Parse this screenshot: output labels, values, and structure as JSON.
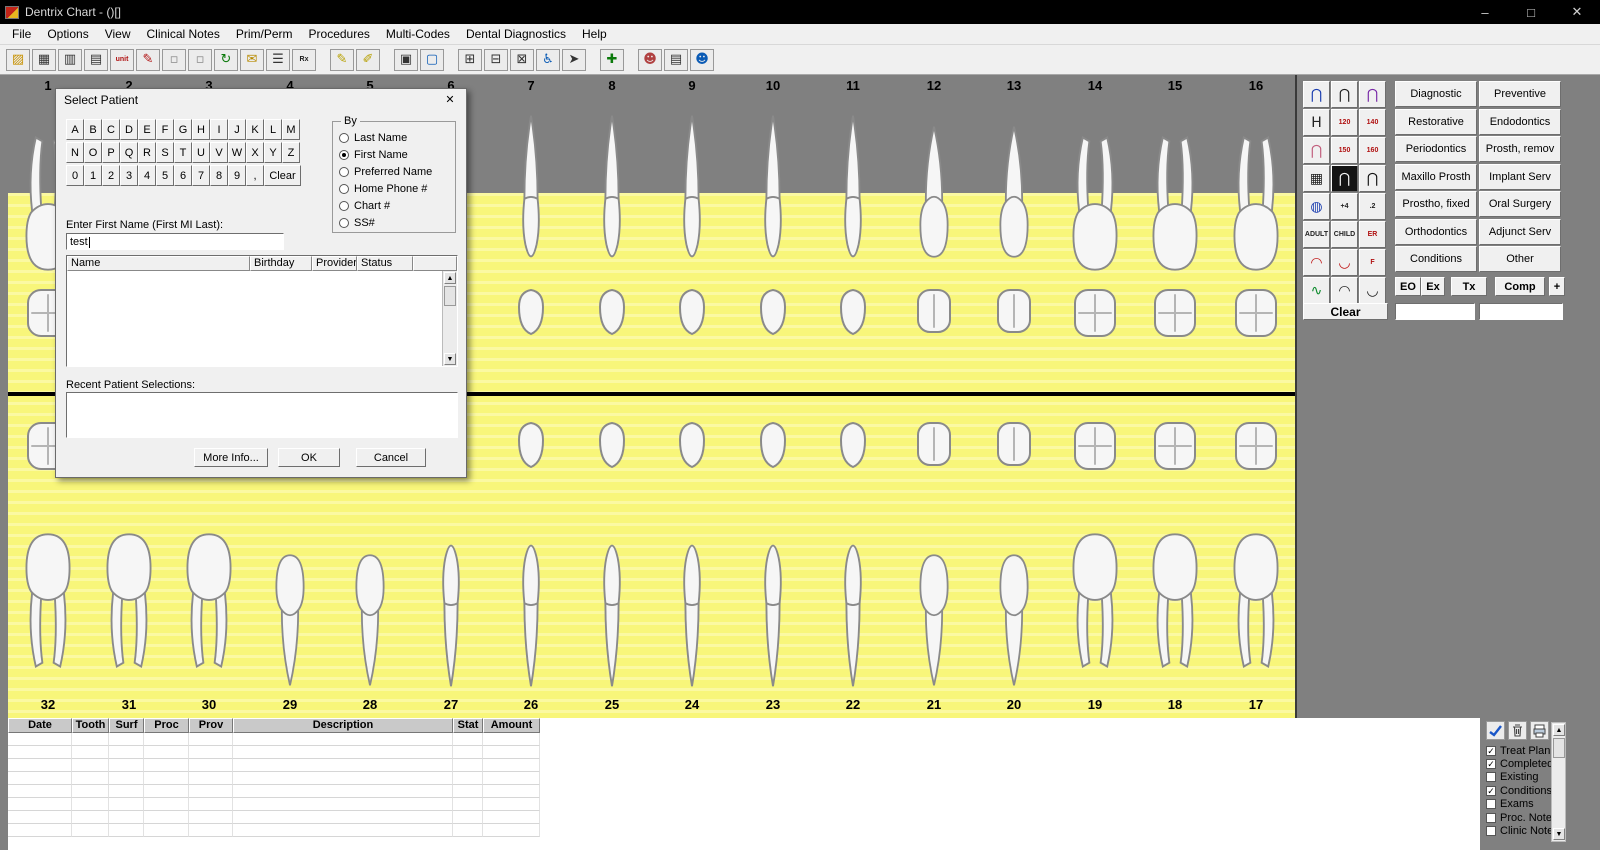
{
  "window": {
    "title": "Dentrix Chart - ()[]",
    "controls": {
      "minimize": "–",
      "maximize": "□",
      "close": "✕"
    }
  },
  "menu": {
    "items": [
      "File",
      "Options",
      "View",
      "Clinical Notes",
      "Prim/Perm",
      "Procedures",
      "Multi-Codes",
      "Dental Diagnostics",
      "Help"
    ]
  },
  "toolbar": {
    "buttons": [
      {
        "name": "open-patient-icon",
        "glyph": "▨",
        "color": "#c79100"
      },
      {
        "name": "appointment-list-icon",
        "glyph": "▦",
        "color": "#333333"
      },
      {
        "name": "family-file-icon",
        "glyph": "▥",
        "color": "#333333"
      },
      {
        "name": "print-chart-icon",
        "glyph": "▤",
        "color": "#333333"
      },
      {
        "name": "perio-unit-icon",
        "glyph": "unit",
        "color": "#b01010",
        "text": true
      },
      {
        "name": "clinical-notes-icon",
        "glyph": "✎",
        "color": "#b01010"
      },
      {
        "name": "primary-teeth-icon",
        "glyph": "▫",
        "color": "#8a8a8a"
      },
      {
        "name": "mixed-dentition-icon",
        "glyph": "▫",
        "color": "#8a8a8a"
      },
      {
        "name": "refresh-icon",
        "glyph": "↻",
        "color": "#0c7a0c"
      },
      {
        "name": "email-icon",
        "glyph": "✉",
        "color": "#b78a00"
      },
      {
        "name": "office-journal-icon",
        "glyph": "☰",
        "color": "#333333"
      },
      {
        "name": "prescriptions-icon",
        "glyph": "Rx",
        "color": "#202020",
        "text": true
      },
      {
        "sep": true
      },
      {
        "name": "exam-pencil-icon",
        "glyph": "✎",
        "color": "#b7a000"
      },
      {
        "name": "eraser-icon",
        "glyph": "✐",
        "color": "#b7a000"
      },
      {
        "sep": true
      },
      {
        "name": "image-capture-icon",
        "glyph": "▣",
        "color": "#333333"
      },
      {
        "name": "monitor-icon",
        "glyph": "▢",
        "color": "#0b5bb5"
      },
      {
        "sep": true
      },
      {
        "name": "window-layout-icon",
        "glyph": "⊞",
        "color": "#333333"
      },
      {
        "name": "zoom-layout-icon",
        "glyph": "⊟",
        "color": "#333333"
      },
      {
        "name": "column-layout-icon",
        "glyph": "⊠",
        "color": "#333333"
      },
      {
        "name": "patient-chair-icon",
        "glyph": "♿",
        "color": "#0b5bb5"
      },
      {
        "name": "pointer-tool-icon",
        "glyph": "➤",
        "color": "#333333"
      },
      {
        "sep": true
      },
      {
        "name": "add-procedure-icon",
        "glyph": "✚",
        "color": "#0c7a0c"
      },
      {
        "sep": true
      },
      {
        "name": "patient-picture-icon",
        "glyph": "☻",
        "color": "#b04040"
      },
      {
        "name": "print-preview-icon",
        "glyph": "▤",
        "color": "#333333"
      },
      {
        "name": "staff-list-icon",
        "glyph": "☻",
        "color": "#0b5bb5"
      }
    ]
  },
  "chart": {
    "upper_teeth": [
      "1",
      "2",
      "3",
      "4",
      "5",
      "6",
      "7",
      "8",
      "9",
      "10",
      "11",
      "12",
      "13",
      "14",
      "15",
      "16"
    ],
    "lower_teeth": [
      "32",
      "31",
      "30",
      "29",
      "28",
      "27",
      "26",
      "25",
      "24",
      "23",
      "22",
      "21",
      "20",
      "19",
      "18",
      "17"
    ],
    "tooth_types": [
      "molar",
      "molar",
      "molar",
      "premolar",
      "premolar",
      "canine",
      "incisor",
      "incisor",
      "incisor",
      "incisor",
      "canine",
      "premolar",
      "premolar",
      "molar",
      "molar",
      "molar"
    ],
    "colors": {
      "gum": "#ec7e71",
      "gum_stripe": "#f4a89a",
      "background": "#f8f67a",
      "background_stripe": "#fbf9a2"
    }
  },
  "dialog": {
    "title": "Select Patient",
    "close_glyph": "✕",
    "letter_rows": [
      [
        "A",
        "B",
        "C",
        "D",
        "E",
        "F",
        "G",
        "H",
        "I",
        "J",
        "K",
        "L",
        "M"
      ],
      [
        "N",
        "O",
        "P",
        "Q",
        "R",
        "S",
        "T",
        "U",
        "V",
        "W",
        "X",
        "Y",
        "Z"
      ],
      [
        "0",
        "1",
        "2",
        "3",
        "4",
        "5",
        "6",
        "7",
        "8",
        "9",
        ",",
        "Clear"
      ]
    ],
    "by_group": {
      "legend": "By",
      "options": [
        {
          "label": "Last Name",
          "selected": false
        },
        {
          "label": "First Name",
          "selected": true
        },
        {
          "label": "Preferred Name",
          "selected": false
        },
        {
          "label": "Home Phone #",
          "selected": false
        },
        {
          "label": "Chart #",
          "selected": false
        },
        {
          "label": "SS#",
          "selected": false
        }
      ]
    },
    "input_label": "Enter First Name (First MI Last):",
    "input_value": "test",
    "results": {
      "columns": [
        "Name",
        "Birthday",
        "Provider",
        "Status"
      ]
    },
    "recent_label": "Recent Patient Selections:",
    "buttons": {
      "more_info": "More Info...",
      "ok": "OK",
      "cancel": "Cancel"
    }
  },
  "right_panel": {
    "clear_label": "Clear",
    "row_buttons": [
      "EO",
      "Ex",
      "Tx",
      "Comp",
      "+"
    ],
    "categories": [
      [
        "Diagnostic",
        "Preventive"
      ],
      [
        "Restorative",
        "Endodontics"
      ],
      [
        "Periodontics",
        "Prosth, remov"
      ],
      [
        "Maxillo Prosth",
        "Implant Serv"
      ],
      [
        "Prostho, fixed",
        "Oral Surgery"
      ],
      [
        "Orthodontics",
        "Adjunct Serv"
      ],
      [
        "Conditions",
        "Other"
      ]
    ],
    "icon_grid": [
      {
        "name": "implant-tooth-icon",
        "glyph": "⋂",
        "color": "#1d3fb0"
      },
      {
        "name": "veneer-tooth-icon",
        "glyph": "⋂",
        "color": "#222222"
      },
      {
        "name": "crown-tooth-icon",
        "glyph": "⋂",
        "color": "#7a2ba8"
      },
      {
        "name": "bridge-icon",
        "glyph": "Η",
        "color": "#222222"
      },
      {
        "name": "perio-probe-120-icon",
        "glyph": "120",
        "color": "#b01010",
        "text": true
      },
      {
        "name": "perio-probe-140-icon",
        "glyph": "140",
        "color": "#b01010",
        "text": true
      },
      {
        "name": "denture-tooth-icon",
        "glyph": "⋂",
        "color": "#c2607e"
      },
      {
        "name": "perio-probe-150-icon",
        "glyph": "150",
        "color": "#b01010",
        "text": true
      },
      {
        "name": "perio-probe-160-icon",
        "glyph": "160",
        "color": "#b01010",
        "text": true
      },
      {
        "name": "partial-denture-icon",
        "glyph": "▦",
        "color": "#222222"
      },
      {
        "name": "missing-tooth-icon",
        "glyph": "⋂",
        "color": "#f2f2f2",
        "bg": "#141414"
      },
      {
        "name": "watch-tooth-icon",
        "glyph": "⋂",
        "color": "#141414"
      },
      {
        "name": "sealant-icon",
        "glyph": "◍",
        "color": "#1d3fb0"
      },
      {
        "name": "quadrant-plus4-icon",
        "glyph": "+4",
        "color": "#222222",
        "text": true
      },
      {
        "name": "quadrant-dot2-icon",
        "glyph": ".2",
        "color": "#222222",
        "text": true
      },
      {
        "name": "adult-dentition-icon",
        "glyph": "ADULT",
        "color": "#222222",
        "text": true
      },
      {
        "name": "child-dentition-icon",
        "glyph": "CHILD",
        "color": "#222222",
        "text": true
      },
      {
        "name": "emergency-tooth-icon",
        "glyph": "ER",
        "color": "#b01010",
        "text": true
      },
      {
        "name": "upper-arch-icon",
        "glyph": "◠",
        "color": "#c01818"
      },
      {
        "name": "lower-arch-icon",
        "glyph": "◡",
        "color": "#c01818"
      },
      {
        "name": "fluoride-tooth-icon",
        "glyph": "F",
        "color": "#b01010",
        "text": true
      },
      {
        "name": "perio-exam-icon",
        "glyph": "∿",
        "color": "#0c8a2c"
      },
      {
        "name": "arch-band-icon",
        "glyph": "◠",
        "color": "#222222"
      },
      {
        "name": "clasp-icon",
        "glyph": "◡",
        "color": "#222222"
      }
    ]
  },
  "progress_notes": {
    "columns": [
      "Date",
      "Tooth",
      "Surf",
      "Proc",
      "Prov",
      "Description",
      "Stat",
      "Amount"
    ],
    "filters": [
      {
        "label": "Treat Plan",
        "checked": true
      },
      {
        "label": "Completed",
        "checked": true
      },
      {
        "label": "Existing",
        "checked": false
      },
      {
        "label": "Conditions",
        "checked": true
      },
      {
        "label": "Exams",
        "checked": false
      },
      {
        "label": "Proc. Notes",
        "checked": false
      },
      {
        "label": "Clinic Notes",
        "checked": false
      }
    ]
  }
}
